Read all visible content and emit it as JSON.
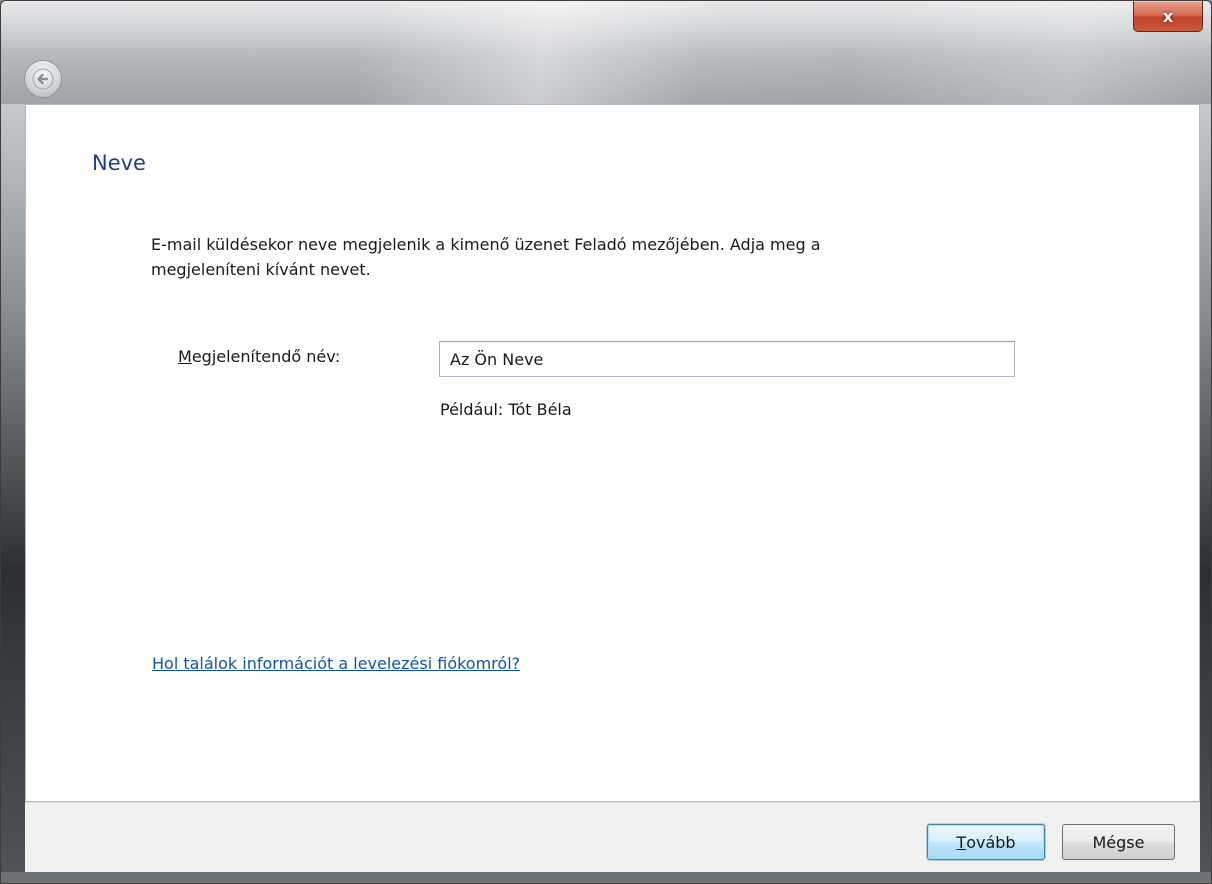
{
  "titlebar": {
    "back_icon": "back-arrow-icon",
    "close_label": "x",
    "close_icon": "close-icon"
  },
  "main": {
    "title": "Neve",
    "description": "E-mail küldésekor neve megjelenik a kimenő üzenet Feladó mezőjében. Adja meg a megjeleníteni kívánt nevet.",
    "name_label_underlined": "M",
    "name_label_rest": "egjelenítendő név:",
    "name_input_value": "Az Ön Neve",
    "example": "Például: Tót Béla",
    "help_link": "Hol találok információt a levelezési fiókomról?"
  },
  "footer": {
    "next_underlined": "T",
    "next_rest": "ovább",
    "cancel_label": "Mégse"
  },
  "colors": {
    "title": "#1c3f94",
    "link": "#0f56a8",
    "close_button": "#c0442a",
    "footer_bg": "#f0f0f0"
  }
}
